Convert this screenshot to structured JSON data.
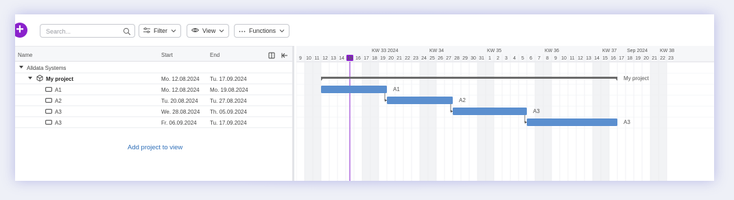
{
  "toolbar": {
    "add_label": "+",
    "search_placeholder": "Search...",
    "filter_label": "Filter",
    "view_label": "View",
    "functions_label": "Functions"
  },
  "grid": {
    "columns": {
      "name": "Name",
      "start": "Start",
      "end": "End"
    },
    "rows": [
      {
        "name": "Alldata Systems",
        "start": "",
        "end": "",
        "kind": "group"
      },
      {
        "name": "My project",
        "start": "Mo. 12.08.2024",
        "end": "Tu. 17.09.2024",
        "kind": "project"
      },
      {
        "name": "A1",
        "start": "Mo. 12.08.2024",
        "end": "Mo. 19.08.2024",
        "kind": "task"
      },
      {
        "name": "A2",
        "start": "Tu. 20.08.2024",
        "end": "Tu. 27.08.2024",
        "kind": "task"
      },
      {
        "name": "A3",
        "start": "We. 28.08.2024",
        "end": "Th. 05.09.2024",
        "kind": "task"
      },
      {
        "name": "A3",
        "start": "Fr. 06.09.2024",
        "end": "Tu. 17.09.2024",
        "kind": "task"
      }
    ],
    "add_project_label": "Add project to view"
  },
  "timeline": {
    "weeks": [
      {
        "label": "KW 33 2024",
        "day_index": 9
      },
      {
        "label": "KW 34",
        "day_index": 16
      },
      {
        "label": "KW 35",
        "day_index": 23
      },
      {
        "label": "KW 36",
        "day_index": 30
      },
      {
        "label": "KW 37",
        "day_index": 37
      },
      {
        "label": "Sep 2024",
        "day_index": 40
      },
      {
        "label": "KW 38",
        "day_index": 44
      }
    ],
    "days": [
      "9",
      "10",
      "11",
      "12",
      "13",
      "14",
      "15",
      "16",
      "17",
      "18",
      "19",
      "20",
      "21",
      "22",
      "23",
      "24",
      "25",
      "26",
      "27",
      "28",
      "29",
      "30",
      "31",
      "1",
      "2",
      "3",
      "4",
      "5",
      "6",
      "7",
      "8",
      "9",
      "10",
      "11",
      "12",
      "13",
      "14",
      "15",
      "16",
      "17",
      "18",
      "19",
      "20",
      "21",
      "22",
      "23"
    ],
    "today_index": 6,
    "weekend_indices": [
      1,
      2,
      8,
      9,
      15,
      16,
      22,
      23,
      29,
      30,
      36,
      37,
      43,
      44
    ],
    "bars": [
      {
        "label": "My project",
        "start": 3,
        "end": 39,
        "row": 1,
        "kind": "summary"
      },
      {
        "label": "A1",
        "start": 3,
        "end": 11,
        "row": 2,
        "kind": "task"
      },
      {
        "label": "A2",
        "start": 11,
        "end": 19,
        "row": 3,
        "kind": "task"
      },
      {
        "label": "A3",
        "start": 19,
        "end": 28,
        "row": 4,
        "kind": "task"
      },
      {
        "label": "A3",
        "start": 28,
        "end": 39,
        "row": 5,
        "kind": "task"
      }
    ],
    "colors": {
      "bar": "#5b8fcf",
      "summary": "#6b6b6b",
      "today": "#8a21cc",
      "weekend": "#f2f3f5"
    }
  }
}
